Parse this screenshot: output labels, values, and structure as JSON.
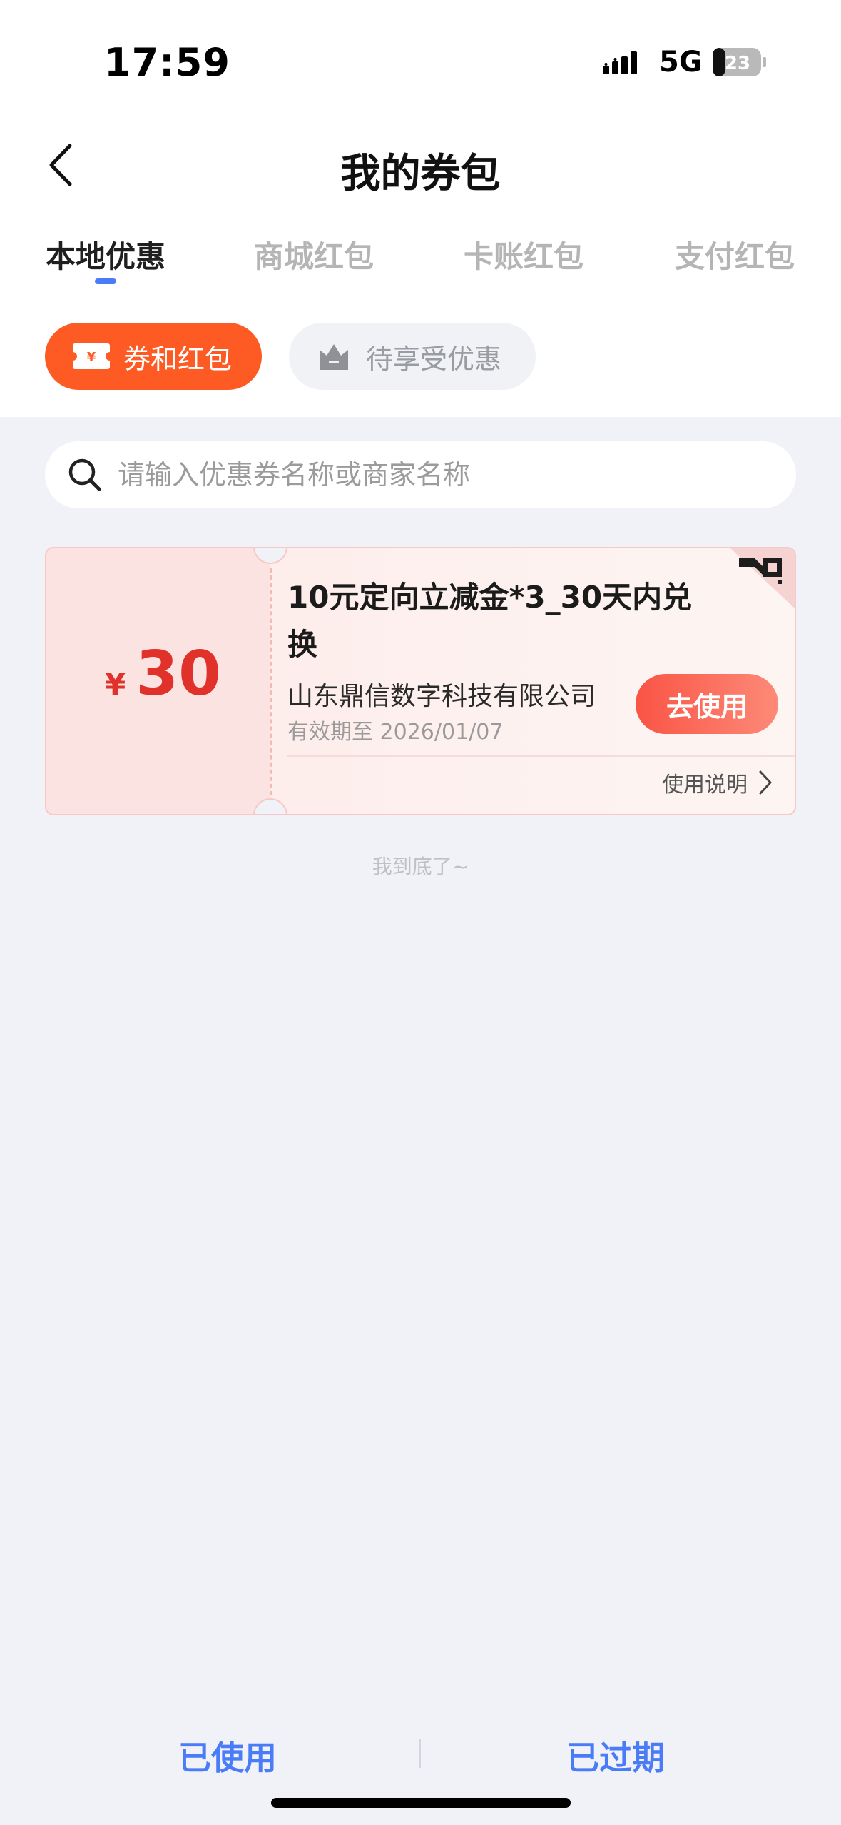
{
  "status_bar": {
    "time": "17:59",
    "network": "5G",
    "battery": "23"
  },
  "nav": {
    "title": "我的券包"
  },
  "tabs": [
    {
      "label": "本地优惠",
      "active": true
    },
    {
      "label": "商城红包",
      "active": false
    },
    {
      "label": "卡账红包",
      "active": false
    },
    {
      "label": "支付红包",
      "active": false
    }
  ],
  "filters": {
    "coupon_label": "券和红包",
    "pending_label": "待享受优惠"
  },
  "search": {
    "placeholder": "请输入优惠券名称或商家名称"
  },
  "coupon": {
    "currency": "¥",
    "amount": "30",
    "title": "10元定向立减金*3_30天内兑换",
    "merchant": "山东鼎信数字科技有限公司",
    "expiry": "有效期至 2026/01/07",
    "use_label": "去使用",
    "usage_label": "使用说明"
  },
  "end_text": "我到底了~",
  "bottom": {
    "used_label": "已使用",
    "expired_label": "已过期"
  },
  "colors": {
    "accent_orange": "#fd5a24",
    "amount_red": "#e0322a",
    "link_blue": "#4a7cf7"
  }
}
